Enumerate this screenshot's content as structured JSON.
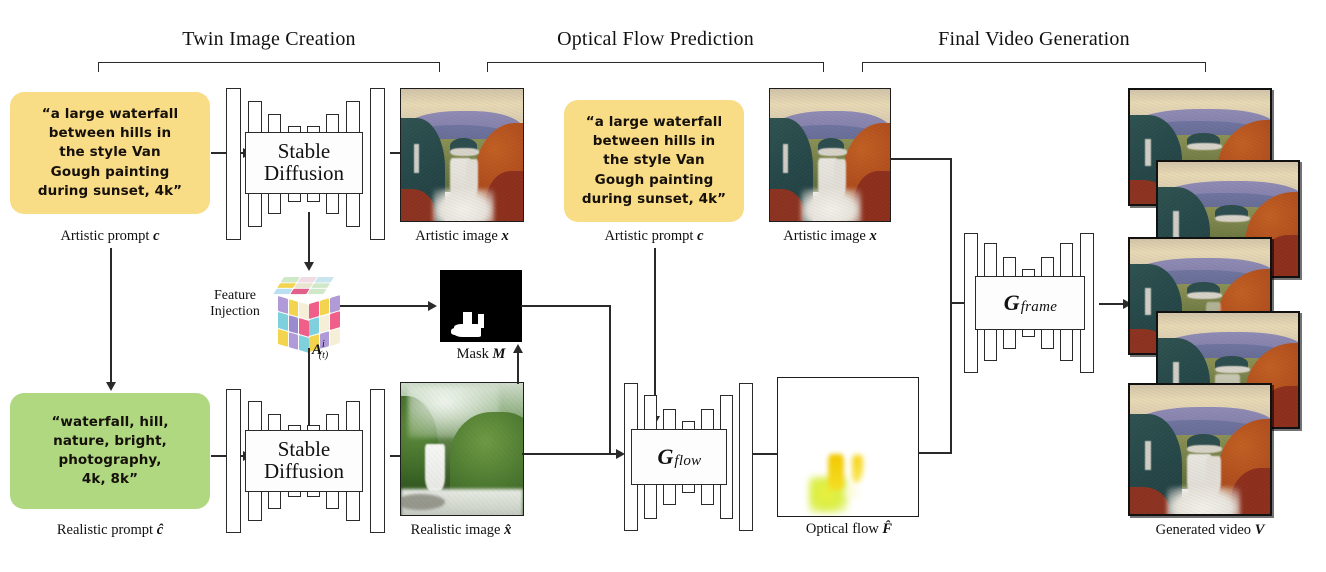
{
  "figure": {
    "title": "Twin image creation, optical flow prediction and final video generation pipeline",
    "type": "diagram"
  },
  "sections": [
    {
      "id": "twin",
      "title": "Twin Image Creation"
    },
    {
      "id": "flow",
      "title": "Optical Flow Prediction"
    },
    {
      "id": "video",
      "title": "Final Video Generation"
    }
  ],
  "prompts": {
    "artistic_top": {
      "text": "“a large waterfall\nbetween hills in\nthe style Van\nGough painting\nduring sunset, 4k”",
      "color": "#F9DC86",
      "caption": "Artistic prompt c"
    },
    "artistic_mid": {
      "text": "“a large waterfall\nbetween hills in\nthe style Van\nGough painting\nduring sunset, 4k”",
      "color": "#F9DC86",
      "caption": "Artistic prompt c"
    },
    "realistic": {
      "text": "“waterfall, hill,\nnature, bright,\nphotography,\n4k, 8k”",
      "color": "#AFD880",
      "caption": "Realistic prompt ĉ"
    }
  },
  "networks": {
    "sd_top": {
      "label_line1": "Stable",
      "label_line2": "Diffusion"
    },
    "sd_bottom": {
      "label_line1": "Stable",
      "label_line2": "Diffusion"
    },
    "g_flow": {
      "label_main": "G",
      "label_sub": "flow"
    },
    "g_frame": {
      "label_main": "G",
      "label_sub": "frame"
    }
  },
  "nodes": {
    "feature_injection": {
      "label_line1": "Feature",
      "label_line2": "Injection",
      "tensor_label": "A",
      "tensor_sup": "i",
      "tensor_sub": "(t)"
    },
    "mask": {
      "caption": "Mask M"
    },
    "artistic_image_left": {
      "caption": "Artistic image x"
    },
    "artistic_image_mid": {
      "caption": "Artistic image x"
    },
    "realistic_image": {
      "caption": "Realistic image x̂"
    },
    "optical_flow_output": {
      "caption": "Optical flow F̂"
    },
    "generated_video": {
      "caption": "Generated video V",
      "frame_count": 5
    }
  },
  "colors": {
    "stroke": "#2a2a2a",
    "prompt_artistic": "#F9DC86",
    "prompt_realistic": "#AFD880",
    "mask_bg": "#000000",
    "mask_fg": "#ffffff",
    "flow_yellow": "#F2C800",
    "flow_green": "#D9EE4A"
  },
  "cube_colors": {
    "top": [
      "#cfe8c8",
      "#f0dde4",
      "#c9e6ef",
      "#f2d44f",
      "#e8e4cf",
      "#cfe8c8",
      "#b9dff0",
      "#e0608a",
      "#cfe8c8"
    ],
    "left": [
      "#b09bd8",
      "#f2d44f",
      "#f6efd8",
      "#7fd0dd",
      "#9a8ad0",
      "#ef5f8a",
      "#f2d44f",
      "#b09bd8",
      "#7fd0dd"
    ],
    "right": [
      "#ef5f8a",
      "#f2d44f",
      "#b09bd8",
      "#7fd0dd",
      "#f6efd8",
      "#ef5f8a",
      "#f2d44f",
      "#b09bd8",
      "#f6efd8"
    ]
  }
}
